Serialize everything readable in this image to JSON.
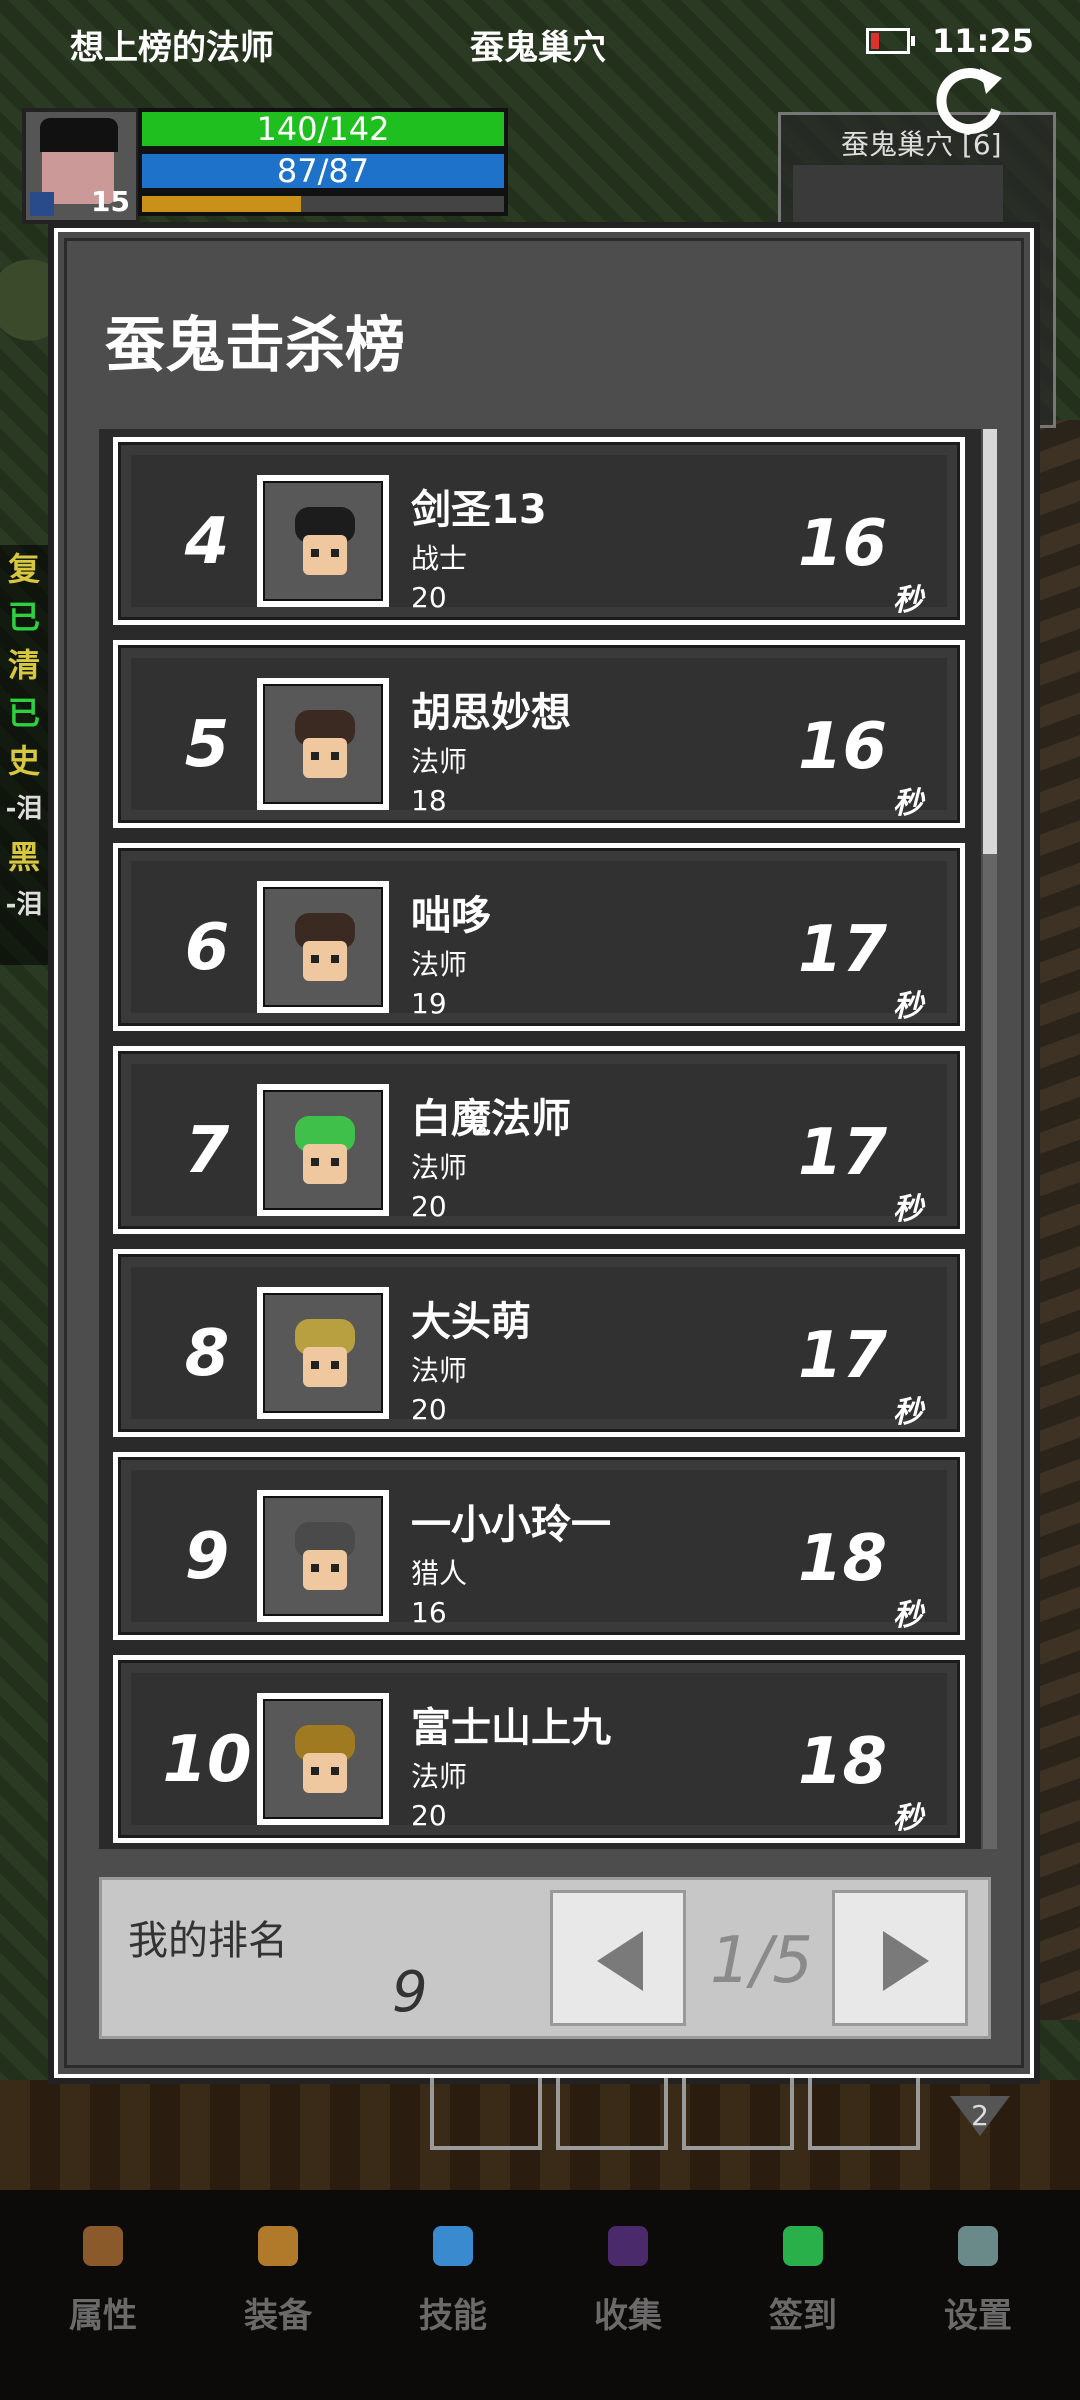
{
  "status_bar": {
    "player_name": "想上榜的法师",
    "zone_name": "蚕鬼巢穴",
    "time": "11:25"
  },
  "hud": {
    "level": "15",
    "hp_text": "140/142",
    "mp_text": "87/87",
    "xp_fraction": 0.44,
    "map_title": "蚕鬼巢穴 [6]"
  },
  "left_strip": [
    "复",
    "已",
    "清",
    "已",
    "史",
    "-泪",
    "黑",
    "-泪"
  ],
  "dialog": {
    "title": "蚕鬼击杀榜",
    "entries": [
      {
        "rank": "4",
        "name": "剑圣13",
        "class": "战士",
        "level": "20",
        "time": "16",
        "unit": "秒",
        "icon": "horned-helmet-icon"
      },
      {
        "rank": "5",
        "name": "胡思妙想",
        "class": "法师",
        "level": "18",
        "time": "16",
        "unit": "秒",
        "icon": "mage-hood-icon"
      },
      {
        "rank": "6",
        "name": "咄哆",
        "class": "法师",
        "level": "19",
        "time": "17",
        "unit": "秒",
        "icon": "mage-hood-icon"
      },
      {
        "rank": "7",
        "name": "白魔法师",
        "class": "法师",
        "level": "20",
        "time": "17",
        "unit": "秒",
        "icon": "green-hair-mage-icon"
      },
      {
        "rank": "8",
        "name": "大头萌",
        "class": "法师",
        "level": "20",
        "time": "17",
        "unit": "秒",
        "icon": "gold-skull-icon"
      },
      {
        "rank": "9",
        "name": "一小小玲一",
        "class": "猎人",
        "level": "16",
        "time": "18",
        "unit": "秒",
        "icon": "plumed-helmet-icon"
      },
      {
        "rank": "10",
        "name": "富士山上九",
        "class": "法师",
        "level": "20",
        "time": "18",
        "unit": "秒",
        "icon": "gold-mask-icon"
      }
    ],
    "my_rank_label": "我的排名",
    "my_rank_value": "9",
    "page_indicator": "1/5"
  },
  "badge_count": "2",
  "nav": [
    {
      "label": "属性",
      "icon": "helmet-icon",
      "color": "#8a5a2a"
    },
    {
      "label": "装备",
      "icon": "bag-icon",
      "color": "#b07a2a"
    },
    {
      "label": "技能",
      "icon": "skill-orb-icon",
      "color": "#3a8ad0"
    },
    {
      "label": "收集",
      "icon": "book-icon",
      "color": "#4a2a6a"
    },
    {
      "label": "签到",
      "icon": "gem-icon",
      "color": "#2ab04a"
    },
    {
      "label": "设置",
      "icon": "gear-icon",
      "color": "#6a8a8a"
    }
  ],
  "colors": {
    "hp": "#1fbf1f",
    "mp": "#1e72c9",
    "xp": "#c9901a",
    "left_strip_text": "#d8c840"
  }
}
